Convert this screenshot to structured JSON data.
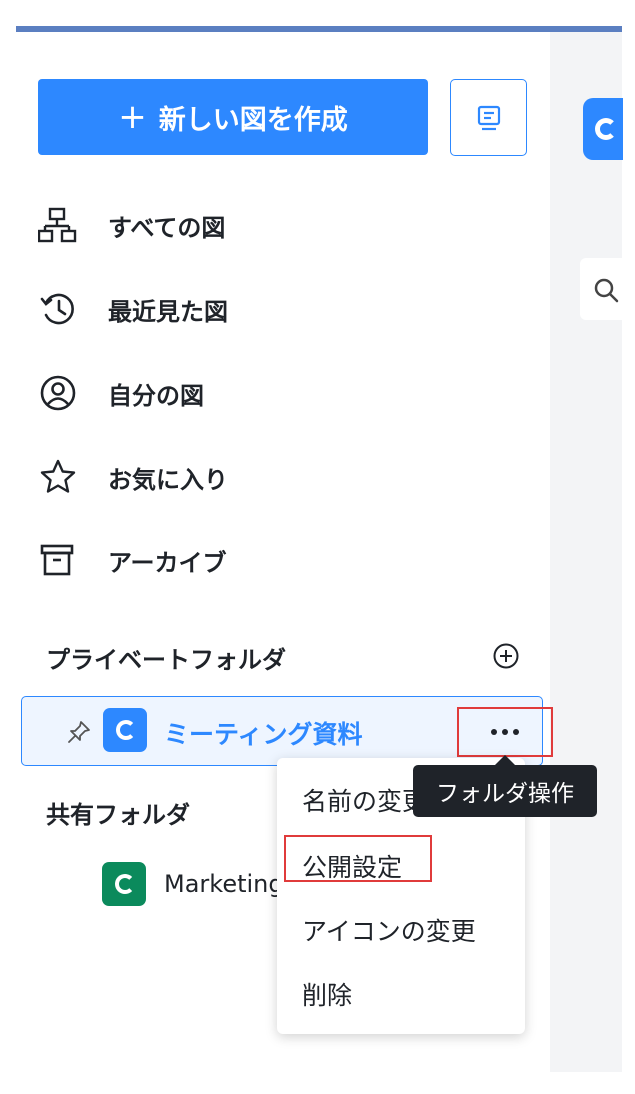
{
  "sidebar": {
    "create_button": {
      "icon": "plus-icon",
      "label": "新しい図を作成"
    },
    "template_button": {
      "icon": "template-icon"
    },
    "nav": [
      {
        "icon": "diagram-tree-icon",
        "label": "すべての図"
      },
      {
        "icon": "history-icon",
        "label": "最近見た図"
      },
      {
        "icon": "user-circle-icon",
        "label": "自分の図"
      },
      {
        "icon": "star-icon",
        "label": "お気に入り"
      },
      {
        "icon": "archive-icon",
        "label": "アーカイブ"
      }
    ],
    "private_folders": {
      "title": "プライベートフォルダ",
      "add_icon": "plus-circle-icon",
      "items": [
        {
          "name": "ミーティング資料",
          "pin_icon": "pin-icon",
          "logo_color": "#2d88ff"
        }
      ]
    },
    "shared_folders": {
      "title": "共有フォルダ",
      "items": [
        {
          "name": "Marketing",
          "logo_color": "#0b8a5c"
        }
      ]
    }
  },
  "context_menu": {
    "items": [
      "名前の変更",
      "公開設定",
      "アイコンの変更",
      "削除"
    ],
    "highlighted_index": 1
  },
  "tooltip": {
    "text": "フォルダ操作"
  },
  "colors": {
    "accent": "#2d88ff",
    "highlight_border": "#e03b3b",
    "top_bar": "#5b7fc1"
  }
}
